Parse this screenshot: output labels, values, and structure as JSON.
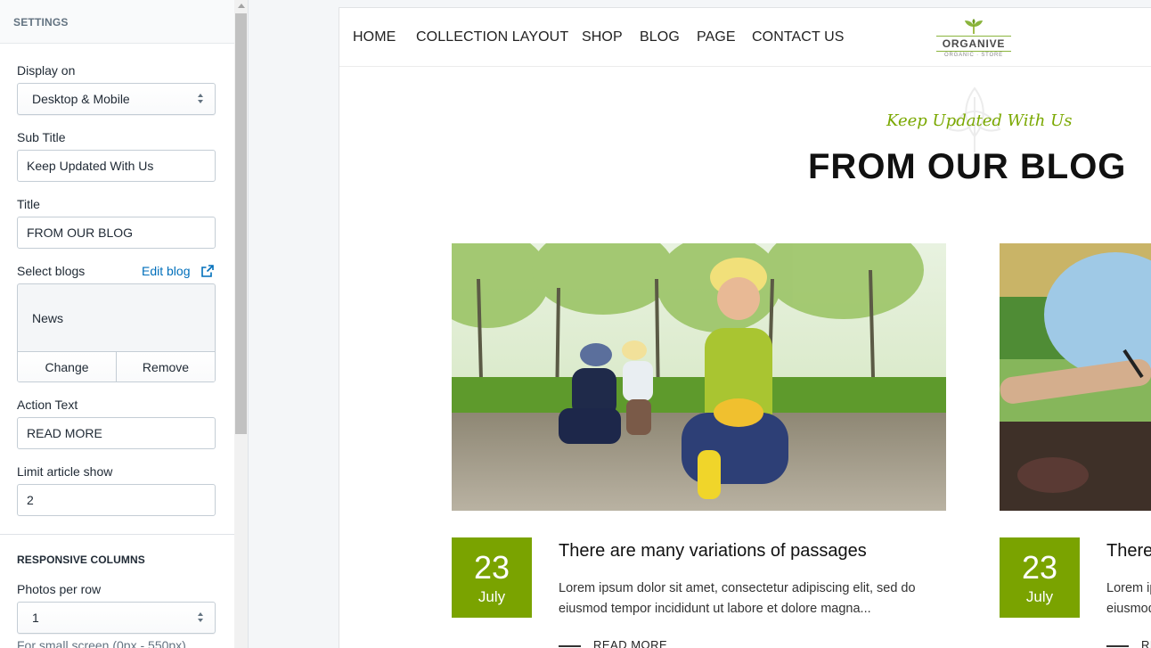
{
  "settings": {
    "header": "SETTINGS",
    "display_on": {
      "label": "Display on",
      "value": "Desktop & Mobile"
    },
    "sub_title": {
      "label": "Sub Title",
      "value": "Keep Updated With Us"
    },
    "title": {
      "label": "Title",
      "value": "FROM OUR BLOG"
    },
    "select_blogs": {
      "label": "Select blogs",
      "edit_link": "Edit blog",
      "selected": "News",
      "change_button": "Change",
      "remove_button": "Remove"
    },
    "action_text": {
      "label": "Action Text",
      "value": "READ MORE"
    },
    "limit_article": {
      "label": "Limit article show",
      "value": "2"
    },
    "responsive_header": "RESPONSIVE COLUMNS",
    "photos_per_row": {
      "label": "Photos per row",
      "value": "1"
    },
    "small_screen_note": "For small screen (0px - 550px)"
  },
  "preview": {
    "nav": [
      "HOME",
      "COLLECTION LAYOUT",
      "SHOP",
      "BLOG",
      "PAGE",
      "CONTACT US"
    ],
    "logo": {
      "name": "ORGANIVE",
      "tagline": "ORGANIC · STORE"
    },
    "subtitle": "Keep Updated With Us",
    "title": "FROM OUR BLOG",
    "posts": [
      {
        "day": "23",
        "month": "July",
        "title": "There are many variations of passages",
        "excerpt": "Lorem ipsum dolor sit amet, consectetur adipiscing elit, sed do eiusmod tempor incididunt ut labore et dolore magna...",
        "read_more": "READ MORE"
      },
      {
        "day": "23",
        "month": "July",
        "title": "There",
        "excerpt_line1": "Lorem ip",
        "excerpt_line2": "eiusmod",
        "read_more": "RE"
      }
    ]
  },
  "colors": {
    "accent_green": "#7aa300",
    "subtitle_green": "#7aa800",
    "link_blue": "#006fbb"
  }
}
